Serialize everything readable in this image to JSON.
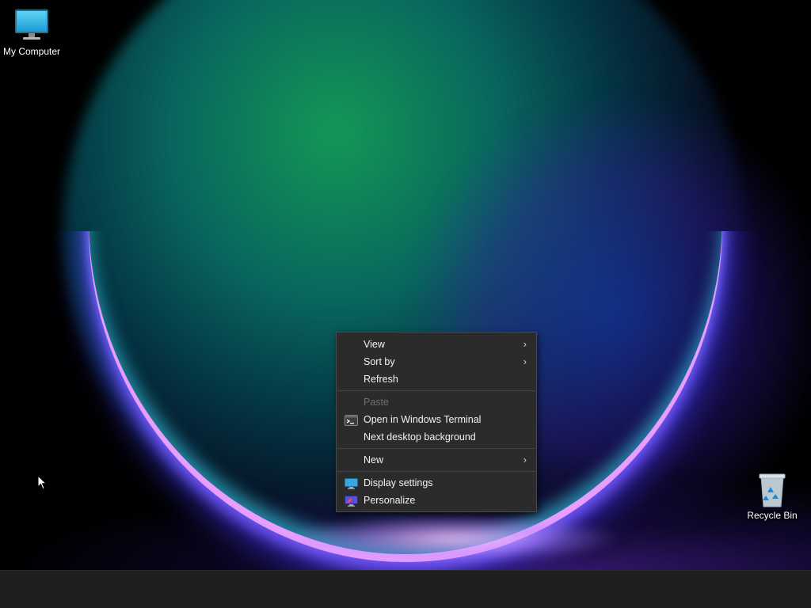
{
  "desktop": {
    "icons": [
      {
        "label": "My Computer",
        "icon": "monitor-icon"
      },
      {
        "label": "Recycle Bin",
        "icon": "recycle-bin-icon"
      }
    ]
  },
  "context_menu": {
    "items": {
      "view": "View",
      "sort_by": "Sort by",
      "refresh": "Refresh",
      "paste": "Paste",
      "open_terminal": "Open in Windows Terminal",
      "next_background": "Next desktop background",
      "new": "New",
      "display_settings": "Display settings",
      "personalize": "Personalize"
    },
    "submenu_indicator": "chevron-right-icon",
    "colors": {
      "background": "#2b2b2b",
      "text": "#f2f2f2",
      "disabled_text": "#6e6e6e"
    }
  },
  "taskbar": {
    "color": "#1f1f1f"
  }
}
